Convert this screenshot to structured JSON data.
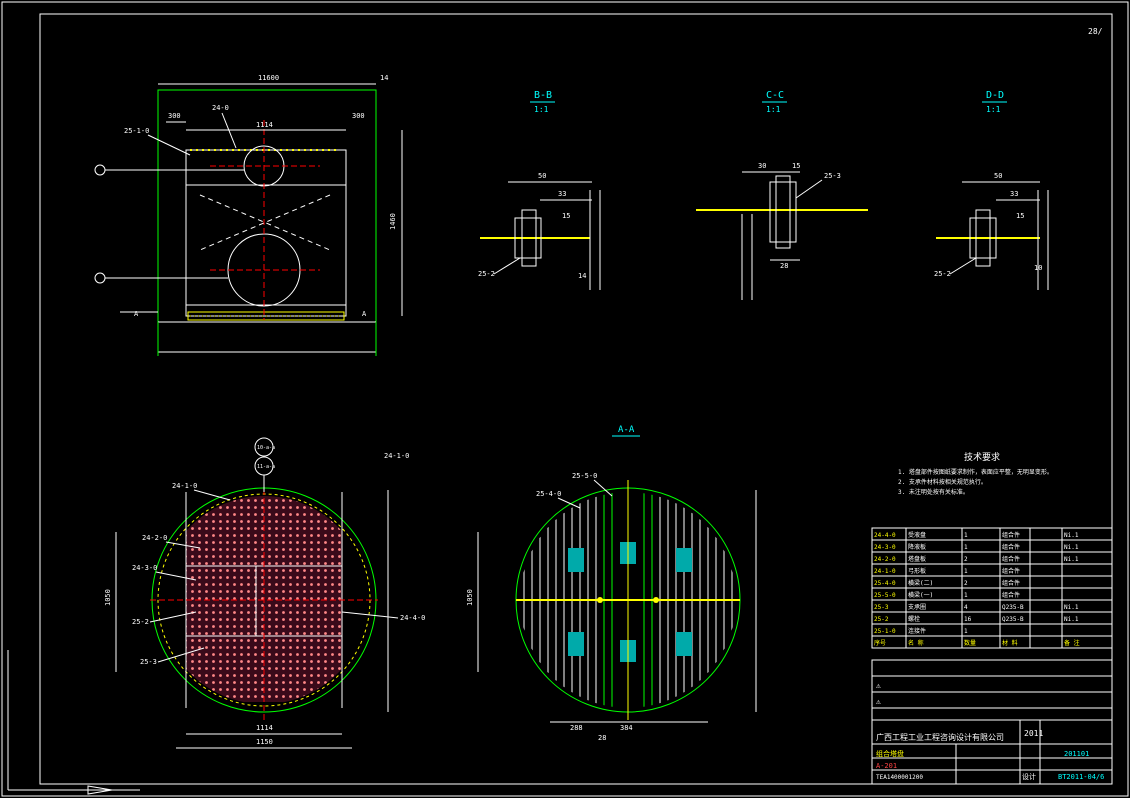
{
  "sheet": {
    "page_marker": "28/",
    "dims": {
      "top_width": "11600",
      "offset_a": "14",
      "left_300": "300",
      "right_300": "300",
      "inner_1114": "1114",
      "right_height": "1460",
      "right_height2": "800"
    },
    "callouts_plan": {
      "part_24_0": "24-0",
      "part_25_1_0": "25-1-0",
      "part_24_1_0_top": "24-1-0",
      "part_24_1_0": "24-1-0",
      "part_24_2_0": "24-2-0",
      "part_24_3_0": "24-3-0",
      "part_25_2": "25-2",
      "part_25_3": "25-3",
      "part_24_4_0": "24-4-0",
      "part_25_5_0": "25-5-0",
      "part_25_4_0": "25-4-0",
      "balloon_1": "10-a-a",
      "balloon_2": "11-a-a"
    },
    "sections": {
      "bb": {
        "title": "B-B",
        "scale": "1:1"
      },
      "cc": {
        "title": "C-C",
        "scale": "1:1"
      },
      "dd": {
        "title": "D-D",
        "scale": "1:1"
      },
      "aa": {
        "title": "A-A"
      }
    },
    "section_dims": {
      "bb_50": "50",
      "bb_33": "33",
      "bb_15": "15",
      "bb_14": "14",
      "bb_part": "25-2",
      "cc_30": "30",
      "cc_15": "15",
      "cc_28": "28",
      "cc_part": "25-3",
      "dd_50": "50",
      "dd_33": "33",
      "dd_15": "15",
      "dd_10": "10",
      "dd_part": "25-2"
    },
    "plan_dims": {
      "w1114": "1114",
      "w1150": "1150",
      "h1050": "1050",
      "aa_1050": "1050",
      "aa_288": "288",
      "aa_384": "384",
      "aa_28": "28"
    },
    "notes": {
      "title": "技术要求",
      "lines": [
        "1. 塔盘部件按图纸要求制作，表面应平整，无明显变形。",
        "2. 支承件材料按相关规范执行。",
        "3. 未注明处按有关标准。"
      ]
    },
    "parts_table": {
      "rows": [
        [
          "24-4-0",
          "受液盘",
          "1",
          "组合件",
          "Ni.1"
        ],
        [
          "24-3-0",
          "降液板",
          "1",
          "组合件",
          "Ni.1"
        ],
        [
          "24-2-0",
          "塔盘板",
          "2",
          "组合件",
          "Ni.1"
        ],
        [
          "24-1-0",
          "弓形板",
          "1",
          "组合件",
          ""
        ],
        [
          "25-4-0",
          "横梁(二)",
          "2",
          "组合件",
          ""
        ],
        [
          "25-5-0",
          "横梁(一)",
          "1",
          "组合件",
          ""
        ],
        [
          "25-3",
          "支承圈",
          "4",
          "Q235-B",
          "Ni.1"
        ],
        [
          "25-2",
          "螺栓",
          "16",
          "Q235-B",
          "Ni.1"
        ],
        [
          "25-1-0",
          "连接件",
          "1",
          "",
          ""
        ]
      ],
      "header": [
        "序号",
        "名 称",
        "数量",
        "材 料",
        "备 注"
      ]
    },
    "title_block": {
      "company": "广西工程工业工程咨询设计有限公司",
      "year": "2011",
      "project_no": "201101",
      "drawing_no": "BT2011-04/6",
      "sub1": "组合塔盘",
      "sub2": "A-201",
      "sub3": "设计",
      "code_left": "TEA1400001200"
    }
  }
}
